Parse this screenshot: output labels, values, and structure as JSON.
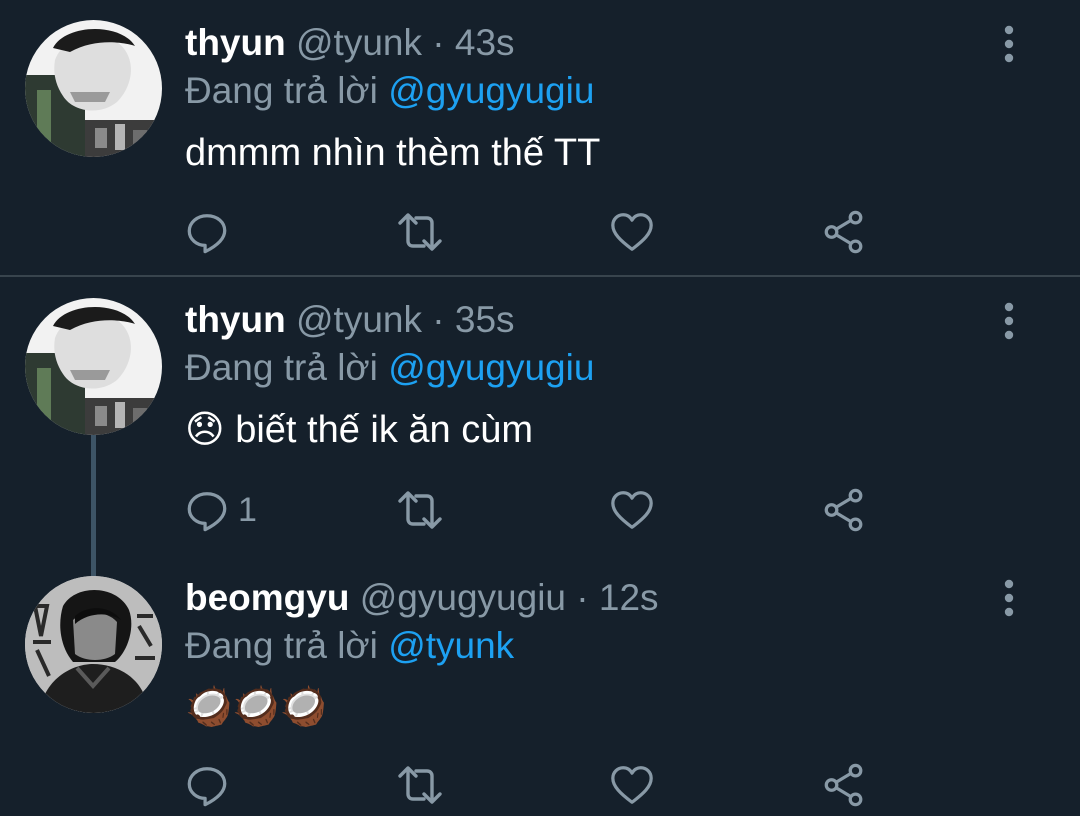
{
  "colors": {
    "background": "#15202b",
    "divider": "#38444d",
    "secondary_text": "#8899a6",
    "mention_blue": "#1da1f2",
    "primary_text": "#ffffff"
  },
  "tweets": [
    {
      "name": "thyun",
      "handle": "@tyunk",
      "separator": "·",
      "time": "43s",
      "reply_prefix": "Đang trả lời",
      "reply_to": "@gyugyugiu",
      "text": "dmmm nhìn thèm thế TT",
      "reply_count": "",
      "icons": [
        "reply-icon",
        "retweet-icon",
        "like-icon",
        "share-icon",
        "more-icon"
      ]
    },
    {
      "name": "thyun",
      "handle": "@tyunk",
      "separator": "·",
      "time": "35s",
      "reply_prefix": "Đang trả lời",
      "reply_to": "@gyugyugiu",
      "emoji": "😞",
      "text": "biết thế ik ăn cùm",
      "reply_count": "1",
      "icons": [
        "reply-icon",
        "retweet-icon",
        "like-icon",
        "share-icon",
        "more-icon"
      ]
    },
    {
      "name": "beomgyu",
      "handle": "@gyugyugiu",
      "separator": "·",
      "time": "12s",
      "reply_prefix": "Đang trả lời",
      "reply_to": "@tyunk",
      "text": "🥥🥥🥥",
      "reply_count": "",
      "icons": [
        "reply-icon",
        "retweet-icon",
        "like-icon",
        "share-icon",
        "more-icon"
      ]
    }
  ]
}
